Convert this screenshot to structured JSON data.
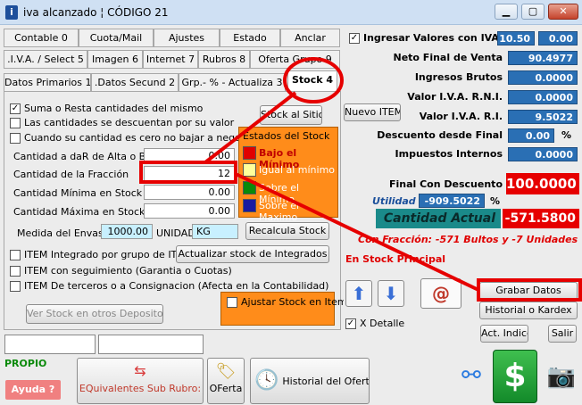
{
  "window": {
    "title": "iva alcanzado ¦ CÓDIGO 21",
    "min": "▁",
    "max": "▢",
    "close": "✕"
  },
  "tabs_row1": [
    "Contable 0",
    "Cuota/Mail",
    "Ajustes",
    "Estado",
    "Anclar"
  ],
  "tabs_row2": [
    ".I.V.A. / Select 5",
    "Imagen 6",
    "Internet 7",
    "Rubros 8",
    "Oferta Grupo 9"
  ],
  "tabs_row3": [
    "Datos Primarios 1",
    ".Datos Secund 2",
    "Grp.- % - Actualiza 3",
    "Stock 4"
  ],
  "stock": {
    "suma_resta": "Suma o Resta cantidades del mismo",
    "descuentan": "Las cantidades se descuentan por su valor",
    "cero": "Cuando su cantidad es cero no bajar a negativo",
    "stock_al_sitio": "Stock al Sitio",
    "alta_label": "Cantidad a daR de Alta o Baja",
    "alta_value": "0.00",
    "fraccion_label": "Cantidad de la Fracción",
    "fraccion_value": "12",
    "minima_label": "Cantidad Mínima en Stock",
    "minima_value": "0.00",
    "maxima_label": "Cantidad Máxima en Stock",
    "maxima_value": "0.00",
    "envase_label": "Medida del Envase",
    "envase_value": "1000.00",
    "unidad_label": "UNIDAD",
    "unidad_value": "KG",
    "recalcula": "Recalcula Stock",
    "integrado": "ITEM Integrado por grupo de ITEMS",
    "actualizar_integrados": "Actualizar stock de Integrados",
    "seguimiento": "ITEM con seguimiento (Garantia o Cuotas)",
    "terceros": "ITEM De terceros o a Consignacion (Afecta en la Contabilidad)",
    "ver_stock": "Ver Stock en otros Depositos",
    "ajustar": "Ajustar Stock en Item"
  },
  "estados": {
    "title": "Estados del Stock",
    "items": [
      {
        "label": "Bajo el Mínimo",
        "color": "#e00000"
      },
      {
        "label": "Igual al mínimo",
        "color": "#ffff9a"
      },
      {
        "label": "Sobre el Mínimo",
        "color": "#0a8a0a"
      },
      {
        "label": "Sobre el Maximo",
        "color": "#1a1aa0"
      }
    ]
  },
  "right": {
    "ingresar_iva": "Ingresar Valores con IVA",
    "iva_a": "10.50",
    "iva_b": "0.00",
    "neto_label": "Neto Final de Venta",
    "neto_value": "90.4977",
    "brutos_label": "Ingresos Brutos",
    "brutos_value": "0.0000",
    "rni_label": "Valor I.V.A. R.N.I.",
    "rni_value": "0.0000",
    "nuevo_item": "Nuevo ITEM",
    "ri_label": "Valor I.V.A. R.I.",
    "ri_value": "9.5022",
    "desc_label": "Descuento desde Final",
    "desc_value": "0.00",
    "desc_pct": "%",
    "internos_label": "Impuestos Internos",
    "internos_value": "0.0000",
    "final_desc_label": "Final Con Descuento",
    "final_desc_value": "100.0000",
    "utilidad_label": "Utilidad",
    "utilidad_value": "-909.5022",
    "utilidad_pct": "%",
    "cantidad_label": "Cantidad Actual",
    "cantidad_value": "-571.5800",
    "fraccion_msg": "Con Fracción: -571 Bultos y -7 Unidades",
    "principal_msg": "En Stock Principal",
    "grabar": "Grabar Datos",
    "historial_kardex": "Historial o Kardex",
    "x_detalle": "X Detalle",
    "act_indices": "Act. Indices",
    "salir": "Salir"
  },
  "bottom": {
    "propio": "PROPIO",
    "ayuda": "Ayuda ?",
    "equivalentes": "EQuivalentes Sub Rubro:",
    "oferta": "OFerta",
    "historial_ofertas": "Historial del Ofertas"
  }
}
